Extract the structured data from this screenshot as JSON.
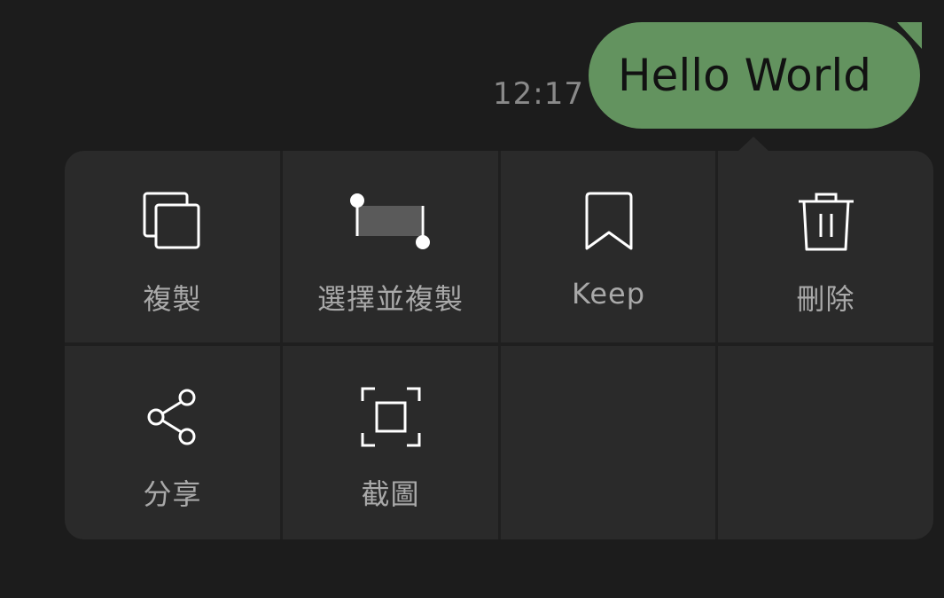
{
  "message": {
    "text": "Hello World",
    "time": "12:17"
  },
  "menu": {
    "items": [
      {
        "label": "複製",
        "icon": "copy-icon"
      },
      {
        "label": "選擇並複製",
        "icon": "select-copy-icon"
      },
      {
        "label": "Keep",
        "icon": "bookmark-icon"
      },
      {
        "label": "刪除",
        "icon": "trash-icon"
      },
      {
        "label": "分享",
        "icon": "share-icon"
      },
      {
        "label": "截圖",
        "icon": "screenshot-icon"
      }
    ]
  },
  "colors": {
    "background": "#1c1c1c",
    "bubble": "#63935f",
    "menu": "#2a2a2a",
    "label": "#a9a9a9"
  }
}
